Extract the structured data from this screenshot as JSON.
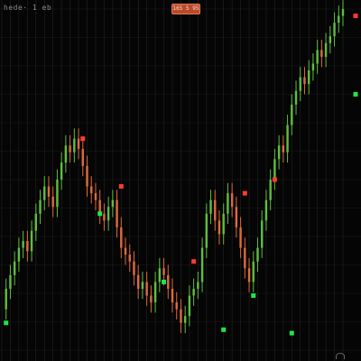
{
  "header": {
    "symbol_text": "hede· 1 eb",
    "badge_text": "165 5 95"
  },
  "colors": {
    "background": "#050505",
    "grid": "#3a3a3a",
    "up": "#5fbf3c",
    "down": "#e06a3c",
    "signal_up": "#1ee64a",
    "signal_down": "#ff3b2f"
  },
  "icons": {
    "corner": "sync-icon"
  },
  "chart_data": {
    "type": "line",
    "title": "",
    "xlabel": "",
    "ylabel": "",
    "x": [
      0,
      1,
      2,
      3,
      4,
      5,
      6,
      7,
      8,
      9,
      10,
      11,
      12,
      13,
      14,
      15,
      16,
      17,
      18,
      19,
      20,
      21,
      22,
      23,
      24,
      25,
      26,
      27,
      28,
      29,
      30,
      31,
      32,
      33,
      34,
      35,
      36,
      37,
      38,
      39,
      40,
      41,
      42,
      43,
      44,
      45,
      46,
      47,
      48,
      49,
      50,
      51,
      52,
      53,
      54,
      55,
      56,
      57,
      58,
      59,
      60,
      61,
      62,
      63,
      64,
      65,
      66,
      67,
      68,
      69,
      70,
      71,
      72,
      73,
      74,
      75,
      76,
      77,
      78,
      79,
      80
    ],
    "ylim": [
      0,
      100
    ],
    "xlim": [
      0,
      80
    ],
    "series": [
      {
        "values": [
          12,
          18,
          22,
          26,
          30,
          32,
          29,
          35,
          40,
          44,
          48,
          45,
          42,
          50,
          55,
          60,
          58,
          62,
          59,
          54,
          48,
          46,
          44,
          40,
          38,
          42,
          44,
          36,
          30,
          28,
          26,
          22,
          18,
          20,
          16,
          14,
          20,
          24,
          22,
          18,
          14,
          12,
          8,
          10,
          16,
          18,
          20,
          30,
          40,
          44,
          38,
          34,
          40,
          46,
          42,
          36,
          30,
          24,
          20,
          26,
          30,
          38,
          44,
          50,
          56,
          60,
          58,
          66,
          72,
          76,
          80,
          78,
          82,
          84,
          88,
          86,
          90,
          92,
          96,
          98,
          100
        ]
      }
    ],
    "markers": [
      {
        "x": 1,
        "y": 8,
        "kind": "buy"
      },
      {
        "x": 19,
        "y": 62,
        "kind": "sell"
      },
      {
        "x": 23,
        "y": 40,
        "kind": "buy"
      },
      {
        "x": 28,
        "y": 48,
        "kind": "sell"
      },
      {
        "x": 38,
        "y": 20,
        "kind": "buy"
      },
      {
        "x": 45,
        "y": 26,
        "kind": "sell"
      },
      {
        "x": 52,
        "y": 6,
        "kind": "buy"
      },
      {
        "x": 57,
        "y": 46,
        "kind": "sell"
      },
      {
        "x": 59,
        "y": 16,
        "kind": "buy"
      },
      {
        "x": 64,
        "y": 50,
        "kind": "sell"
      },
      {
        "x": 68,
        "y": 5,
        "kind": "buy"
      },
      {
        "x": 84,
        "y": 75,
        "kind": "buy"
      },
      {
        "x": 83,
        "y": 98,
        "kind": "sell"
      }
    ],
    "grid": true
  }
}
